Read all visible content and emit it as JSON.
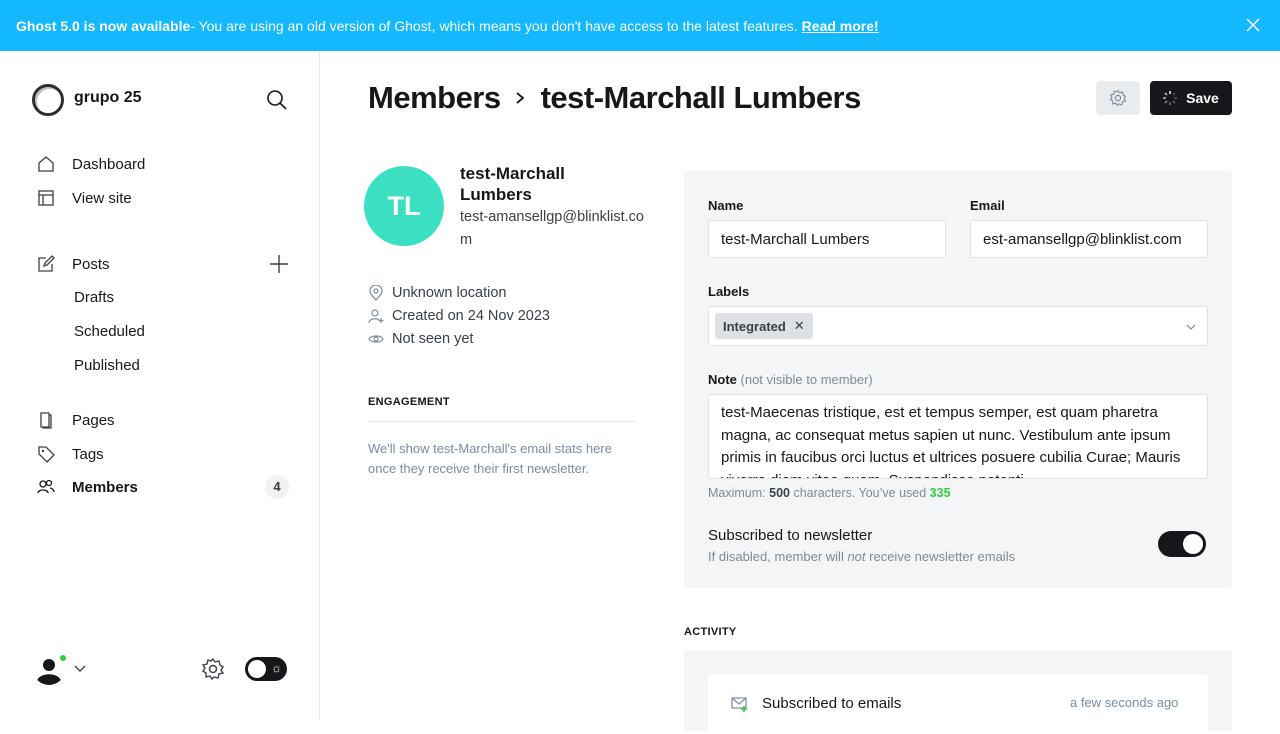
{
  "banner": {
    "bold": "Ghost 5.0 is now available",
    "text": " - You are using an old version of Ghost, which means you don't have access to the latest features.",
    "link": "Read more!"
  },
  "sidebar": {
    "site_name": "grupo 25",
    "items": {
      "dashboard": "Dashboard",
      "view_site": "View site",
      "posts": "Posts",
      "drafts": "Drafts",
      "scheduled": "Scheduled",
      "published": "Published",
      "pages": "Pages",
      "tags": "Tags",
      "members": "Members"
    },
    "members_count": "4"
  },
  "header": {
    "breadcrumb": "Members",
    "title": "test-Marchall Lumbers",
    "save_label": "Save"
  },
  "member": {
    "initials": "TL",
    "name": "test-Marchall Lumbers",
    "email": "test-amansellgp@blinklist.com",
    "location": "Unknown location",
    "created": "Created on 24 Nov 2023",
    "seen": "Not seen yet"
  },
  "engagement": {
    "title": "ENGAGEMENT",
    "text": "We'll show test-Marchall's email stats here once they receive their first newsletter."
  },
  "form": {
    "name_label": "Name",
    "name_value": "test-Marchall Lumbers",
    "email_label": "Email",
    "email_value": "est-amansellgp@blinklist.com",
    "labels_label": "Labels",
    "label_tag": "Integrated",
    "note_label": "Note",
    "note_hint": "(not visible to member)",
    "note_value": "test-Maecenas tristique, est et tempus semper, est quam pharetra magna, ac consequat metus sapien ut nunc. Vestibulum ante ipsum primis in faucibus orci luctus et ultrices posuere cubilia Curae; Mauris viverra diam vitae quam. Suspendisse potenti.",
    "counter_prefix": "Maximum: ",
    "counter_max": "500",
    "counter_mid": " characters. You’ve used ",
    "counter_used": "335",
    "newsletter_title": "Subscribed to newsletter",
    "newsletter_desc_pre": "If disabled, member will ",
    "newsletter_desc_em": "not",
    "newsletter_desc_post": " receive newsletter emails",
    "newsletter_enabled": true
  },
  "activity": {
    "title": "ACTIVITY",
    "items": [
      {
        "text": "Subscribed to emails",
        "time": "a few seconds ago"
      }
    ]
  },
  "colors": {
    "banner": "#14b8ff",
    "avatar": "#3be0c3",
    "accent_green": "#30cf43",
    "dark": "#15171a"
  }
}
